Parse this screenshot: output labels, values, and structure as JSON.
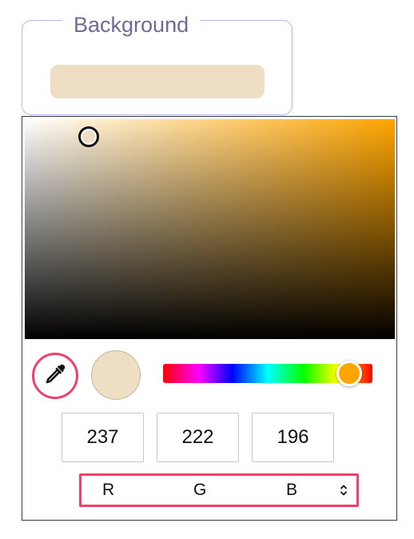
{
  "background_field": {
    "legend": "Background",
    "swatch_color": "#EDDEC4"
  },
  "picker": {
    "base_hue_color": "#FFA500",
    "selected_color": "#EDDEC4",
    "hue_position_fraction": 0.89,
    "eyedropper_icon": "eyedropper-icon",
    "accent_color": "#F0406B",
    "channels": [
      {
        "name": "R",
        "value": "237"
      },
      {
        "name": "G",
        "value": "222"
      },
      {
        "name": "B",
        "value": "196"
      }
    ],
    "mode_labels": [
      "R",
      "G",
      "B"
    ],
    "mode_toggle_icon": "chevron-up-down-icon"
  }
}
